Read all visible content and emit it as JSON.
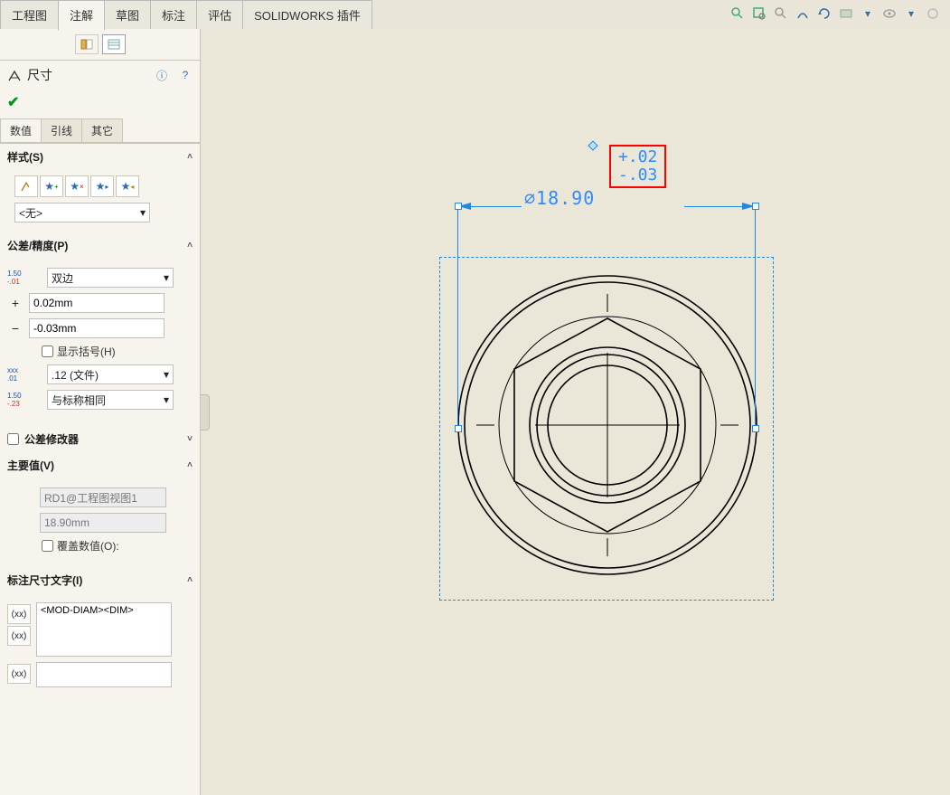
{
  "ribbon": {
    "tabs": [
      "工程图",
      "注解",
      "草图",
      "标注",
      "评估",
      "SOLIDWORKS 插件"
    ],
    "active_index": 1
  },
  "panel": {
    "title": "尺寸",
    "sub_tabs": [
      "数值",
      "引线",
      "其它"
    ],
    "sub_active": 0,
    "style": {
      "header": "样式(S)",
      "selected": "<无>"
    },
    "tolerance": {
      "header": "公差/精度(P)",
      "type": "双边",
      "plus": "0.02mm",
      "minus": "-0.03mm",
      "show_paren": "显示括号(H)",
      "unit_prec": ".12 (文件)",
      "tol_prec": "与标称相同"
    },
    "tol_mod": {
      "header": "公差修改器"
    },
    "primary": {
      "header": "主要值(V)",
      "name": "RD1@工程图视图1",
      "value": "18.90mm",
      "override": "覆盖数值(O):"
    },
    "dim_text": {
      "header": "标注尺寸文字(I)",
      "content": "<MOD-DIAM><DIM>",
      "sym1": "(xx)",
      "sym2": "(xx)",
      "sym3": "(xx)"
    }
  },
  "drawing": {
    "dim_label": "⌀18.90",
    "tol_plus": "+.02",
    "tol_minus": "-.03"
  }
}
